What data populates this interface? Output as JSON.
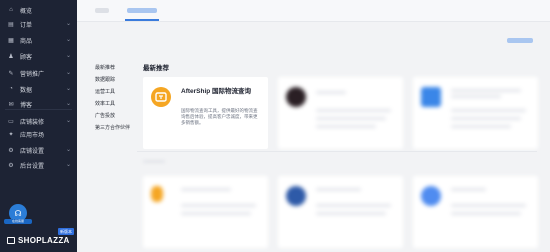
{
  "sidebar": {
    "items": [
      {
        "label": "概览",
        "icon": "home-icon",
        "glyph": "⌂"
      },
      {
        "label": "订单",
        "icon": "order-icon",
        "glyph": "▤"
      },
      {
        "label": "商品",
        "icon": "product-icon",
        "glyph": "▦"
      },
      {
        "label": "顾客",
        "icon": "customer-icon",
        "glyph": "♟"
      },
      {
        "label": "营销推广",
        "icon": "marketing-icon",
        "glyph": "✎"
      },
      {
        "label": "数据",
        "icon": "analytics-icon",
        "glyph": "◔"
      },
      {
        "label": "博客",
        "icon": "blog-icon",
        "glyph": "✉"
      },
      {
        "label": "店铺装修",
        "icon": "store-design-icon",
        "glyph": "▭"
      },
      {
        "label": "应用市场",
        "icon": "app-market-icon",
        "glyph": "✦"
      },
      {
        "label": "店铺设置",
        "icon": "store-settings-icon",
        "glyph": "⚙"
      },
      {
        "label": "后台设置",
        "icon": "admin-settings-icon",
        "glyph": "⚙"
      }
    ],
    "support_label": "在线客服",
    "version_badge": "新版本",
    "brand_name": "SHOPLAZZA"
  },
  "categories": [
    "最新推荐",
    "数据跟踪",
    "运营工具",
    "效率工具",
    "广告投放",
    "第三方合作伙伴"
  ],
  "section_title": "最新推荐",
  "featured_card": {
    "title": "AfterShip 国际物流查询",
    "description": "国际物流查询工具，提供最好的物流查询售后体验，提高客户忠诚度，带来更多销售额。",
    "icon_color": "#f5a623"
  },
  "colors": {
    "sidebar_bg": "#1d2334",
    "accent": "#3a7bdc",
    "featured_icon": "#f5a623"
  }
}
